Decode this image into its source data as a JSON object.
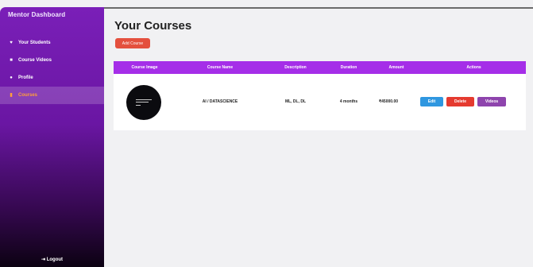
{
  "sidebar": {
    "title": "Mentor Dashboard",
    "items": [
      {
        "label": "Your Students",
        "icon": "users-icon",
        "active": false
      },
      {
        "label": "Course Videos",
        "icon": "video-icon",
        "active": false
      },
      {
        "label": "Profile",
        "icon": "user-icon",
        "active": false
      },
      {
        "label": "Courses",
        "icon": "book-icon",
        "active": true
      }
    ],
    "logout_label": "Logout",
    "active_color": "#ff9f3a"
  },
  "main": {
    "title": "Your Courses",
    "add_button": "Add Course"
  },
  "table": {
    "headers": [
      "Course Image",
      "Course Name",
      "Description",
      "Duration",
      "Amount",
      "Actions"
    ],
    "rows": [
      {
        "name": "AI / DATASCIENCE",
        "description": "ML, DL, DL",
        "duration": "4 months",
        "amount": "₹45000.00",
        "actions": {
          "edit": "Edit",
          "delete": "Delete",
          "videos": "Videos"
        }
      }
    ]
  },
  "colors": {
    "header": "#a52ee8",
    "add_button": "#e4503e",
    "edit": "#2f97e0",
    "delete": "#e53a2f",
    "videos": "#8e44ad"
  }
}
